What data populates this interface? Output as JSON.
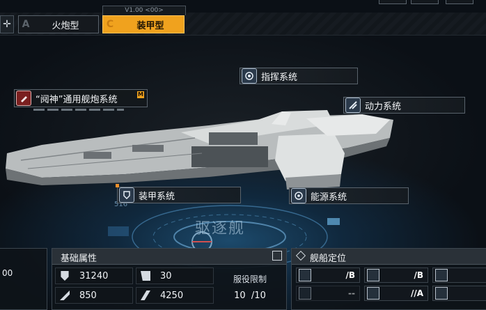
{
  "tabs": {
    "version": "V1.00 <00>",
    "tab_a": {
      "letter": "A",
      "label": "火炮型"
    },
    "tab_c": {
      "letter": "C",
      "label": "装甲型"
    }
  },
  "systems": {
    "command": "指挥系统",
    "weapon": "“阋神”通用舰炮系统",
    "weapon_badge": "M",
    "power": "动力系统",
    "armor": "装甲系统",
    "energy": "能源系统"
  },
  "ship_class": "驱逐舰",
  "hull_number": "516",
  "left_value": "00",
  "base_stats": {
    "title": "基础属性",
    "hp": "31240",
    "armor": "30",
    "attack": "850",
    "speed": "4250",
    "service_limit_label": "服役限制",
    "service_limit_value": "10  /10"
  },
  "positioning": {
    "title": "舰船定位",
    "ratings": [
      "/B",
      "/B",
      "--",
      "//A"
    ]
  },
  "colors": {
    "accent": "#f0a21e",
    "panel": "#2a3138"
  }
}
